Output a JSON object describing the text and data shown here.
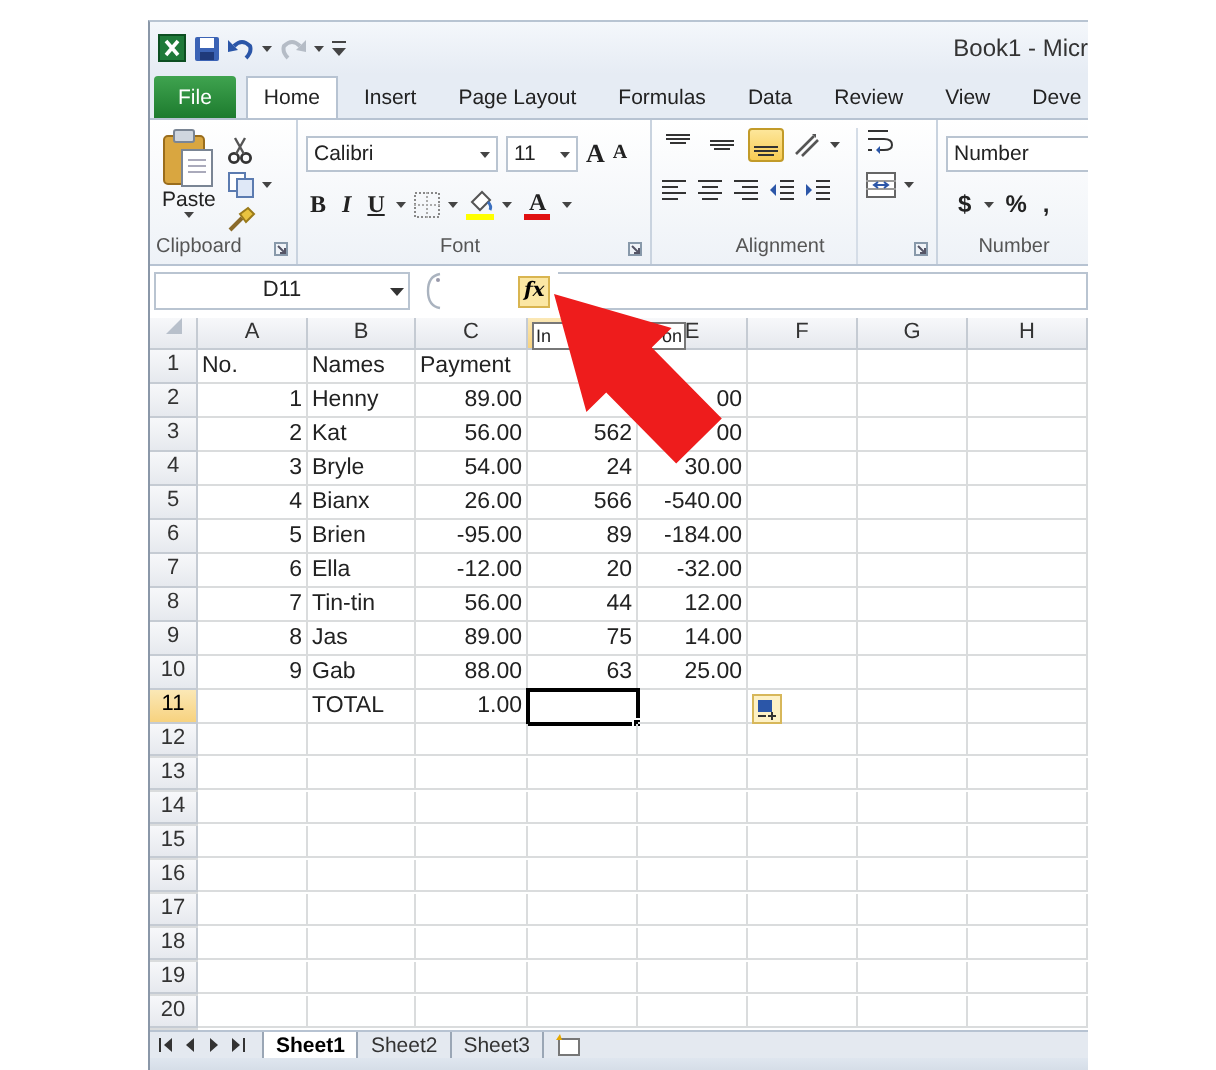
{
  "title_bar": {
    "title": "Book1  -  Micr"
  },
  "tabs": [
    {
      "label": "File",
      "kind": "file",
      "selected": false
    },
    {
      "label": "Home",
      "kind": "tab",
      "selected": true
    },
    {
      "label": "Insert",
      "kind": "tab",
      "selected": false
    },
    {
      "label": "Page Layout",
      "kind": "tab",
      "selected": false
    },
    {
      "label": "Formulas",
      "kind": "tab",
      "selected": false
    },
    {
      "label": "Data",
      "kind": "tab",
      "selected": false
    },
    {
      "label": "Review",
      "kind": "tab",
      "selected": false
    },
    {
      "label": "View",
      "kind": "tab",
      "selected": false
    },
    {
      "label": "Deve",
      "kind": "tab",
      "selected": false
    }
  ],
  "ribbon": {
    "clipboard": {
      "label": "Clipboard",
      "paste": "Paste"
    },
    "font": {
      "label": "Font",
      "font_name": "Calibri",
      "font_size": "11",
      "grow": "A",
      "shrink": "A",
      "font_color": "A",
      "style_buttons": [
        {
          "label": "B",
          "kind": "bold"
        },
        {
          "label": "I",
          "kind": "italic"
        },
        {
          "label": "U",
          "kind": "underline"
        }
      ]
    },
    "alignment": {
      "label": "Alignment",
      "vertical_buttons": [
        {
          "kind": "top",
          "selected": false
        },
        {
          "kind": "middle",
          "selected": false
        },
        {
          "kind": "bottom",
          "selected": true
        }
      ]
    },
    "number": {
      "label": "Number",
      "format": "Number",
      "buttons": [
        "$",
        "%",
        ","
      ]
    }
  },
  "formula_bar": {
    "name_box": "D11",
    "function_button": "fx"
  },
  "tooltip": {
    "parts": [
      "In",
      "on"
    ]
  },
  "columns": [
    {
      "label": "A",
      "selected": false
    },
    {
      "label": "B",
      "selected": false
    },
    {
      "label": "C",
      "selected": false
    },
    {
      "selected": true
    },
    {
      "label": "E",
      "selected": false
    },
    {
      "label": "F",
      "selected": false
    },
    {
      "label": "G",
      "selected": false
    },
    {
      "label": "H",
      "selected": false
    }
  ],
  "rows": [
    {
      "header": "1",
      "selected": false,
      "cells": [
        "No.",
        "Names",
        "Payment",
        "",
        ""
      ]
    },
    {
      "header": "2",
      "selected": false,
      "cells": [
        "1",
        "Henny",
        "89.00",
        "",
        "00"
      ]
    },
    {
      "header": "3",
      "selected": false,
      "cells": [
        "2",
        "Kat",
        "56.00",
        "562",
        "00"
      ]
    },
    {
      "header": "4",
      "selected": false,
      "cells": [
        "3",
        "Bryle",
        "54.00",
        "24",
        "30.00"
      ]
    },
    {
      "header": "5",
      "selected": false,
      "cells": [
        "4",
        "Bianx",
        "26.00",
        "566",
        "-540.00"
      ]
    },
    {
      "header": "6",
      "selected": false,
      "cells": [
        "5",
        "Brien",
        "-95.00",
        "89",
        "-184.00"
      ]
    },
    {
      "header": "7",
      "selected": false,
      "cells": [
        "6",
        "Ella",
        "-12.00",
        "20",
        "-32.00"
      ]
    },
    {
      "header": "8",
      "selected": false,
      "cells": [
        "7",
        "Tin-tin",
        "56.00",
        "44",
        "12.00"
      ]
    },
    {
      "header": "9",
      "selected": false,
      "cells": [
        "8",
        "Jas",
        "89.00",
        "75",
        "14.00"
      ]
    },
    {
      "header": "10",
      "selected": false,
      "cells": [
        "9",
        "Gab",
        "88.00",
        "63",
        "25.00"
      ]
    },
    {
      "header": "11",
      "selected": true,
      "cells": [
        "",
        "TOTAL",
        "1.00",
        "",
        ""
      ]
    },
    {
      "header": "12",
      "selected": false
    },
    {
      "header": "13",
      "selected": false
    },
    {
      "header": "14",
      "selected": false
    },
    {
      "header": "15",
      "selected": false
    },
    {
      "header": "16",
      "selected": false
    },
    {
      "header": "17",
      "selected": false
    },
    {
      "header": "18",
      "selected": false
    },
    {
      "header": "19",
      "selected": false
    },
    {
      "header": "20",
      "selected": false
    }
  ],
  "sheet_tabs": [
    {
      "label": "Sheet1",
      "selected": true
    },
    {
      "label": "Sheet2",
      "selected": false
    },
    {
      "label": "Sheet3",
      "selected": false
    }
  ]
}
